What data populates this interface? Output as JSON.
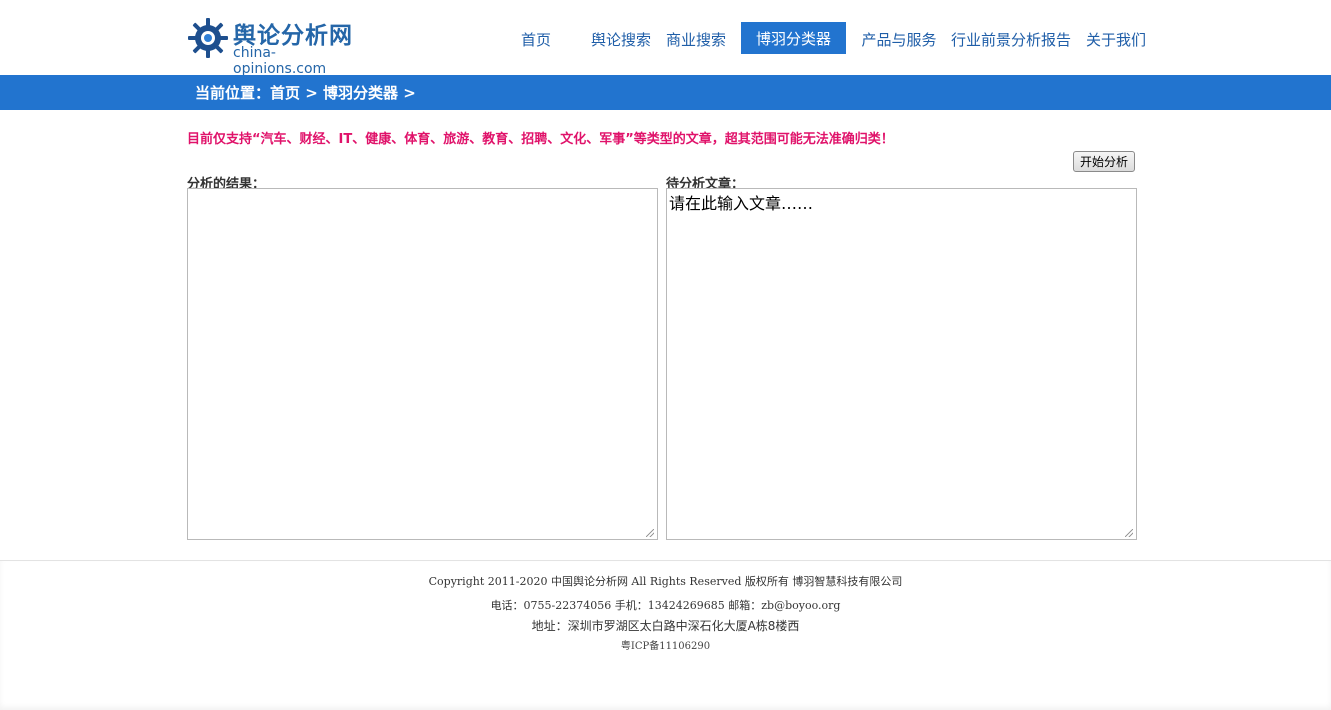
{
  "brand": {
    "title": "舆论分析网",
    "subtitle": "china-opinions.com"
  },
  "nav": {
    "items": [
      {
        "label": "首页"
      },
      {
        "label": "舆论搜索"
      },
      {
        "label": "商业搜索"
      },
      {
        "label": "博羽分类器",
        "active": true
      },
      {
        "label": "产品与服务"
      },
      {
        "label": "行业前景分析报告"
      },
      {
        "label": "关于我们"
      }
    ]
  },
  "breadcrumb": {
    "prefix": "当前位置：",
    "home": "首页",
    "sep1": " > ",
    "current": "博羽分类器",
    "sep2": " >"
  },
  "notice": "目前仅支持“汽车、财经、IT、健康、体育、旅游、教育、招聘、文化、军事”等类型的文章，超其范围可能无法准确归类！",
  "actions": {
    "start_label": "开始分析"
  },
  "result": {
    "label": "分析的结果：",
    "value": ""
  },
  "article": {
    "label": "待分析文章：",
    "value": "请在此输入文章……"
  },
  "footer": {
    "copyright": "Copyright 2011-2020 中国舆论分析网 All Rights Reserved 版权所有 博羽智慧科技有限公司",
    "contact": "电话：0755-22374056 手机：13424269685 邮箱：zb@boyoo.org",
    "address": "地址：深圳市罗湖区太白路中深石化大厦A栋8楼西",
    "icp": "粤ICP备11106290"
  },
  "colors": {
    "accent": "#2274cf",
    "brand": "#2566a8",
    "notice": "#e0126a"
  }
}
